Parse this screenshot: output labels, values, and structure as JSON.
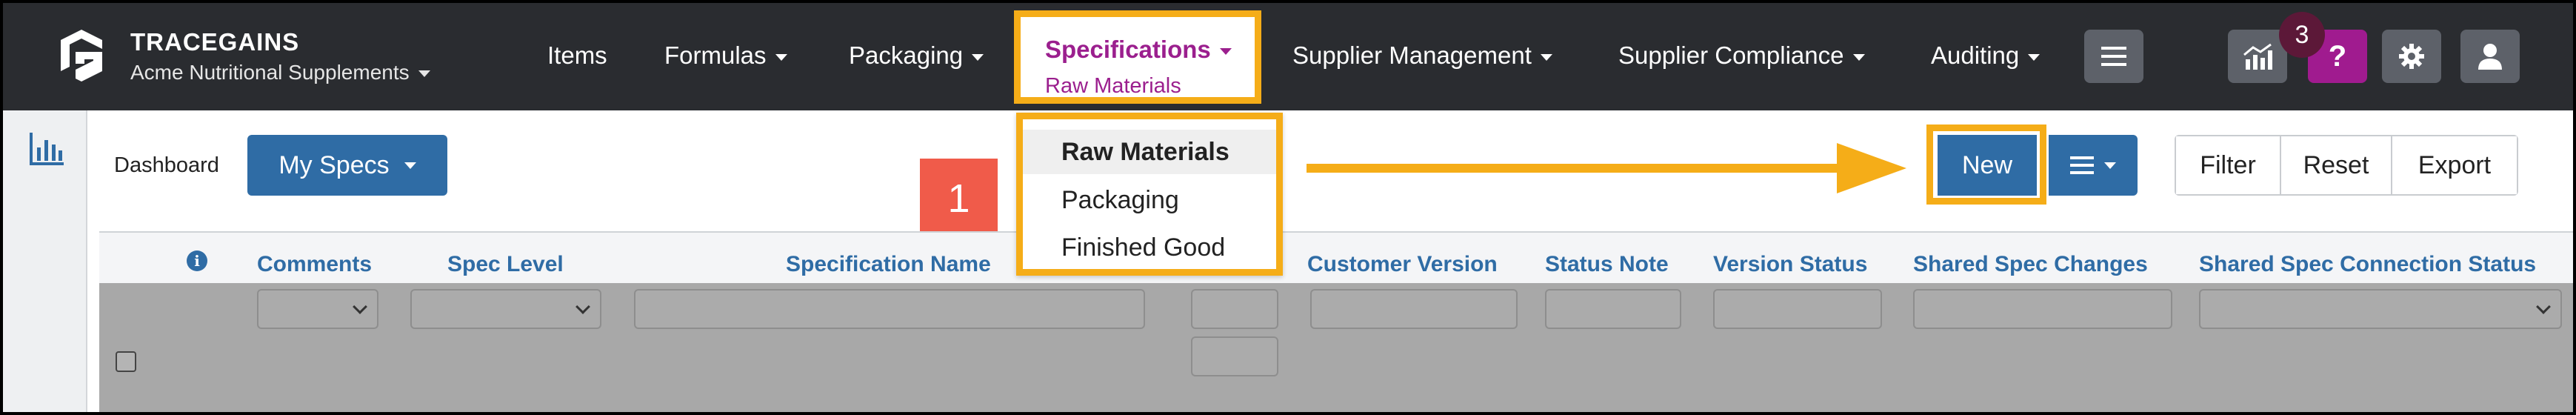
{
  "header": {
    "brand": "TRACEGAINS",
    "company": "Acme Nutritional Supplements",
    "nav": [
      {
        "label": "Items",
        "has_caret": false
      },
      {
        "label": "Formulas",
        "has_caret": true
      },
      {
        "label": "Packaging",
        "has_caret": true
      },
      {
        "label": "Specifications",
        "has_caret": true,
        "active": true
      },
      {
        "label": "Supplier Management",
        "has_caret": true
      },
      {
        "label": "Supplier Compliance",
        "has_caret": true
      },
      {
        "label": "Auditing",
        "has_caret": true
      }
    ],
    "active_sub": "Raw Materials",
    "notification_count": "3",
    "help_label": "?"
  },
  "toolbar": {
    "dashboard_label": "Dashboard",
    "view_selector": "My Specs",
    "step_number": "1",
    "new_label": "New",
    "filter_label": "Filter",
    "reset_label": "Reset",
    "export_label": "Export"
  },
  "spec_menu": {
    "items": [
      "Raw Materials",
      "Packaging",
      "Finished Good"
    ],
    "selected": "Raw Materials"
  },
  "grid": {
    "columns": [
      "Comments",
      "Spec Level",
      "Specification Name",
      "Customer Version",
      "Status Note",
      "Version Status",
      "Shared Spec Changes",
      "Shared Spec Connection Status"
    ]
  },
  "colors": {
    "nav_bg": "#2a2c30",
    "accent_blue": "#2f6ca5",
    "brand_magenta": "#9b1f8e",
    "highlight_orange": "#f5ad18",
    "step_red": "#f05b4a"
  }
}
